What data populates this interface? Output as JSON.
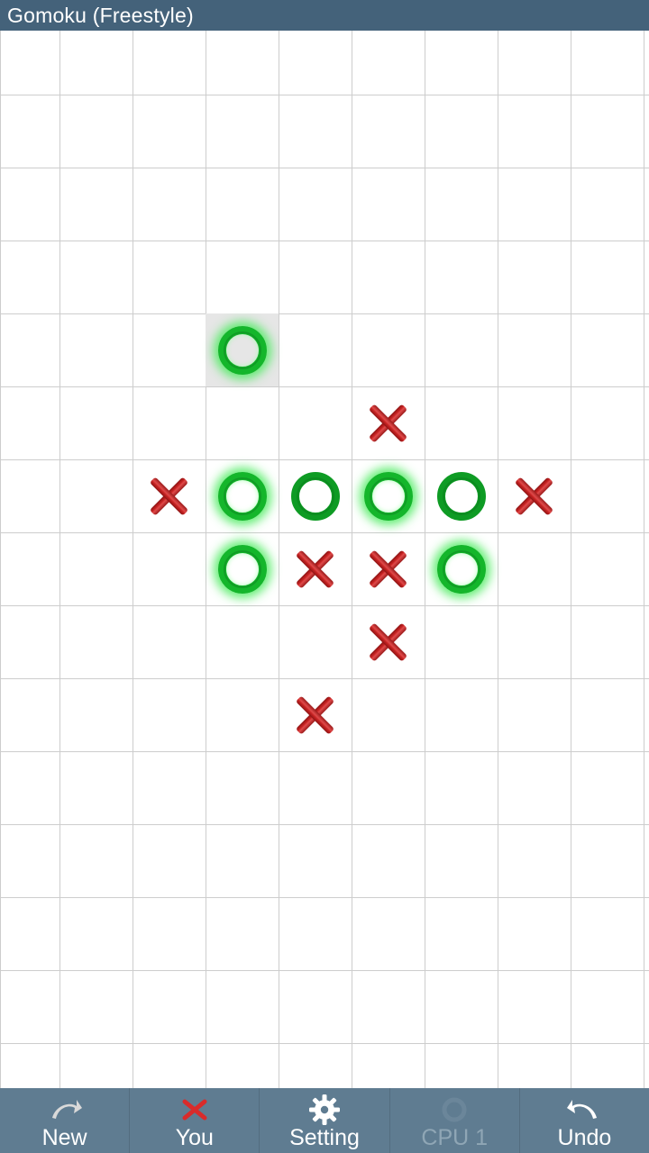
{
  "app": {
    "title": "Gomoku (Freestyle)",
    "title_bar_color": "#44627a",
    "bottom_bar_color": "#5f7c91",
    "board_line_color": "#cdcdcd",
    "x_color": "#c62222",
    "o_color": "#0e9b24",
    "highlight_color": "#e6e6e6"
  },
  "board": {
    "columns": 9,
    "rows": 15,
    "cell_size": 81,
    "stones": [
      {
        "col": 3,
        "row": 4,
        "player": "O",
        "glow": true,
        "highlight": true
      },
      {
        "col": 5,
        "row": 5,
        "player": "X",
        "glow": false,
        "highlight": false
      },
      {
        "col": 2,
        "row": 6,
        "player": "X",
        "glow": false,
        "highlight": false
      },
      {
        "col": 3,
        "row": 6,
        "player": "O",
        "glow": true,
        "highlight": false
      },
      {
        "col": 4,
        "row": 6,
        "player": "O",
        "glow": false,
        "highlight": false
      },
      {
        "col": 5,
        "row": 6,
        "player": "O",
        "glow": true,
        "highlight": false
      },
      {
        "col": 6,
        "row": 6,
        "player": "O",
        "glow": false,
        "highlight": false
      },
      {
        "col": 7,
        "row": 6,
        "player": "X",
        "glow": false,
        "highlight": false
      },
      {
        "col": 3,
        "row": 7,
        "player": "O",
        "glow": true,
        "highlight": false
      },
      {
        "col": 4,
        "row": 7,
        "player": "X",
        "glow": false,
        "highlight": false
      },
      {
        "col": 5,
        "row": 7,
        "player": "X",
        "glow": false,
        "highlight": false
      },
      {
        "col": 6,
        "row": 7,
        "player": "O",
        "glow": true,
        "highlight": false
      },
      {
        "col": 5,
        "row": 8,
        "player": "X",
        "glow": false,
        "highlight": false
      },
      {
        "col": 4,
        "row": 9,
        "player": "X",
        "glow": false,
        "highlight": false
      }
    ]
  },
  "bottom_bar": {
    "items": [
      {
        "label": "New",
        "icon": "redo-arrow-icon",
        "enabled": true
      },
      {
        "label": "You",
        "icon": "x-mark-icon",
        "enabled": true
      },
      {
        "label": "Setting",
        "icon": "gear-icon",
        "enabled": true
      },
      {
        "label": "CPU 1",
        "icon": "circle-icon",
        "enabled": false
      },
      {
        "label": "Undo",
        "icon": "undo-arrow-icon",
        "enabled": true
      }
    ]
  }
}
